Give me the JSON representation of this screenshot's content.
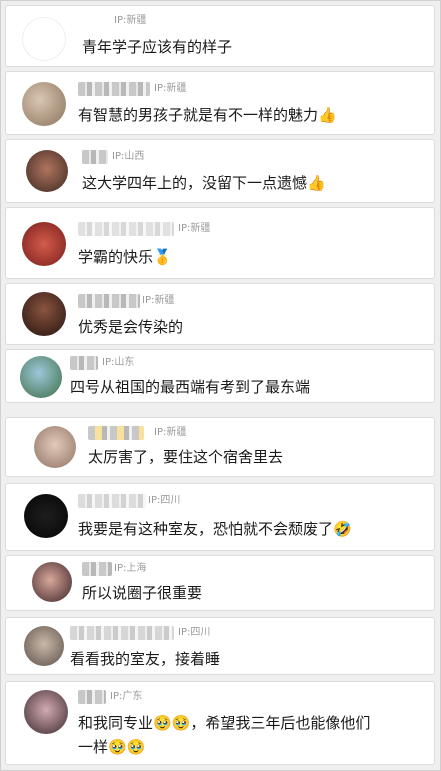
{
  "comments": [
    {
      "ip": "IP:新疆",
      "text": "青年学子应该有的样子",
      "emoji": "",
      "avatar": "#f5f5f5"
    },
    {
      "ip": "IP:新疆",
      "text": "有智慧的男孩子就是有不一样的魅力",
      "emoji": "👍",
      "avatar": "#b49d86"
    },
    {
      "ip": "IP:山西",
      "text": "这大学四年上的，没留下一点遗憾",
      "emoji": "👍",
      "avatar": "#7a4e3c"
    },
    {
      "ip": "IP:新疆",
      "text": "学霸的快乐",
      "emoji": "🥇",
      "avatar": "#a83a32"
    },
    {
      "ip": "IP:新疆",
      "text": "优秀是会传染的",
      "emoji": "",
      "avatar": "#5b2f22"
    },
    {
      "ip": "IP:山东",
      "text": "四号从祖国的最西端有考到了最东端",
      "emoji": "",
      "avatar": "#5f7a5a"
    },
    {
      "ip": "IP:新疆",
      "text": "太厉害了，要住这个宿舍里去",
      "emoji": "",
      "avatar": "#c6a895"
    },
    {
      "ip": "IP:四川",
      "text": "我要是有这种室友，恐怕就不会颓废了",
      "emoji": "🤣",
      "avatar": "#0e0e0e"
    },
    {
      "ip": "IP:上海",
      "text": "所以说圈子很重要",
      "emoji": "",
      "avatar": "#7a4a4a"
    },
    {
      "ip": "IP:四川",
      "text": "看看我的室友，接着睡",
      "emoji": "",
      "avatar": "#8a7a6e"
    },
    {
      "ip": "IP:广东",
      "text": "和我同专业",
      "emoji": "🥹🥹",
      "text2": "，希望我三年后也能像他们",
      "line2": "一样",
      "emoji2": "🥹🥹",
      "avatar": "#6d4e54"
    }
  ]
}
